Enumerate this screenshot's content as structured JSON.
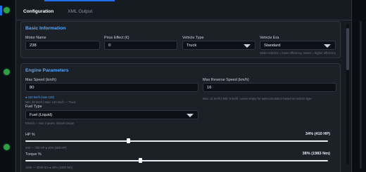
{
  "tabs": [
    {
      "label": "Configuration",
      "active": true
    },
    {
      "label": "XML Output",
      "active": false
    }
  ],
  "basic": {
    "title": "Basic Information",
    "motor_name": {
      "label": "Motor Name",
      "value": "238"
    },
    "price_effect": {
      "label": "Price Effect (€)",
      "value": "0"
    },
    "vehicle_type": {
      "label": "Vehicle Type",
      "value": "Truck"
    },
    "vehicle_era": {
      "label": "Vehicle Era",
      "value": "Standard",
      "hint": "Older vehicles = lower efficiency, newer = higher efficiency"
    }
  },
  "engine": {
    "title": "Engine Parameters",
    "max_speed": {
      "label": "Max Speed (km/h)",
      "value": "80",
      "hint_primary": "● 120 km/h  (max 120)",
      "hint_secondary": "Min: 20 km/h | Max: 120 km/h — Truck"
    },
    "max_reverse": {
      "label": "Max Reverse Speed (km/h)",
      "value": "16",
      "hint": "Max: 31 km/h | Min: 5 km/h. Leave empty for auto-calculation based on vehicle type"
    },
    "fuel_type": {
      "label": "Fuel Type",
      "value": "Fuel (Liquid)",
      "hint": "Electric = max 3 gears, instant torque"
    },
    "hp": {
      "label": "HP %",
      "value_text": "34%  (410 HP)",
      "percent": 34,
      "range_hint": "200 — 750 HP    ●  40% (800 HP)"
    },
    "torque": {
      "label": "Torque %",
      "value_text": "38%  (1983 Nm)",
      "percent": 38,
      "range_hint": "1200 — 3000 Nm    ●  40% (2260 Nm)"
    }
  },
  "colors": {
    "accent": "#58a6ff",
    "status_dot": "#2ea043",
    "panel": "#1c2128",
    "input_bg": "#0d1117"
  }
}
